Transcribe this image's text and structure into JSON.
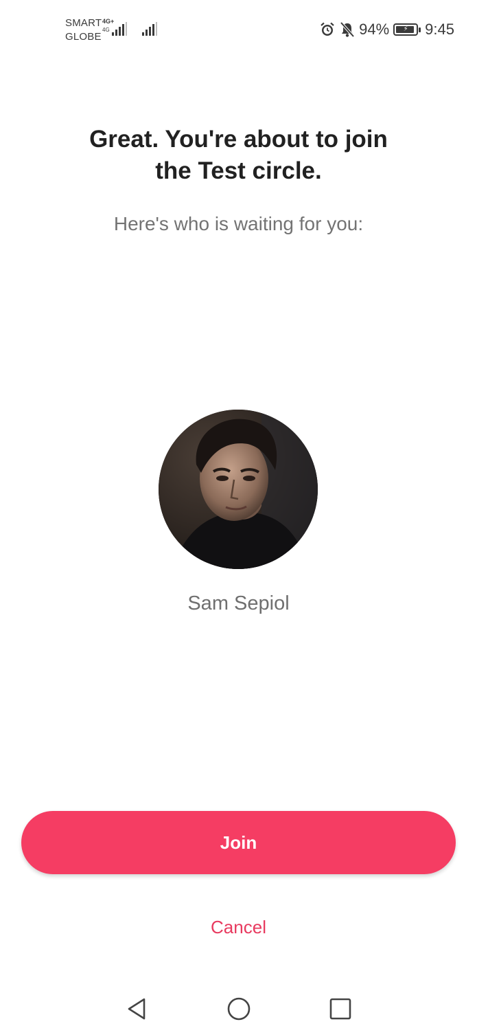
{
  "status_bar": {
    "carrier_line1": "SMART",
    "carrier_line2": "GLOBE",
    "network_type": "4G+",
    "network_sub": "4G",
    "battery_percent": "94%",
    "battery_level": 0.94,
    "time": "9:45",
    "icons": [
      "alarm-icon",
      "bell-off-icon",
      "battery-icon",
      "signal-icon"
    ]
  },
  "invite": {
    "title_line1": "Great. You're about to join",
    "title_line2": "the Test circle.",
    "subtitle": "Here's who is waiting for you:",
    "member_name": "Sam Sepiol"
  },
  "actions": {
    "join_label": "Join",
    "cancel_label": "Cancel"
  },
  "colors": {
    "accent": "#f53d63",
    "cancel_text": "#e83a5f",
    "title_text": "#212121",
    "secondary_text": "#737373"
  },
  "nav_bar": {
    "icons": [
      "back-icon",
      "home-icon",
      "recent-apps-icon"
    ]
  }
}
